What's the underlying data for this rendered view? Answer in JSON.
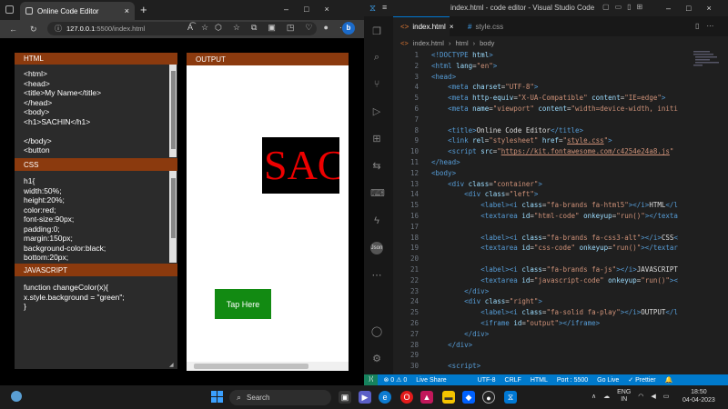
{
  "browser": {
    "tab_title": "Online Code Editor",
    "tab_close": "×",
    "new_tab": "+",
    "address_host": "127.0.0.1",
    "address_path": ":5500/index.html",
    "window_controls": [
      "–",
      "□",
      "×"
    ],
    "icons": [
      "back-icon",
      "reload-icon",
      "info-icon",
      "read-aloud-icon",
      "font-icon",
      "extensions-icon",
      "favorites-icon",
      "collections-icon",
      "profile-icon",
      "bing-icon"
    ]
  },
  "editor": {
    "html_panel": {
      "label": "HTML",
      "code": "<html>\n<head>\n<title>My Name</title>\n</head>\n<body>\n<h1>SACHIN</h1>\n\n</body>\n<button"
    },
    "css_panel": {
      "label": "CSS",
      "code": "h1{\nwidth:50%;\nheight:20%;\ncolor:red;\nfont-size:90px;\npadding:0;\nmargin:150px;\nbackground-color:black;\nbottom:20px;"
    },
    "js_panel": {
      "label": "JAVASCRIPT",
      "code": "function changeColor(x){\nx.style.background = \"green\";\n}"
    },
    "output_panel": {
      "label": "OUTPUT",
      "heading_text": "SACHIN",
      "button_text": "Tap Here"
    }
  },
  "vscode": {
    "title": "index.html - code editor - Visual Studio Code",
    "tabs": [
      {
        "label": "index.html",
        "active": true,
        "close": "×"
      },
      {
        "label": "style.css",
        "active": false
      }
    ],
    "breadcrumb": [
      "index.html",
      "html",
      "body"
    ],
    "lines": [
      {
        "n": "1",
        "html": "<span class=\"tg\">&lt;!DOCTYPE</span> <span class=\"at\">html</span><span class=\"tg\">&gt;</span>"
      },
      {
        "n": "2",
        "html": "<span class=\"tg\">&lt;html</span> <span class=\"at\">lang</span>=<span class=\"st\">\"en\"</span><span class=\"tg\">&gt;</span>"
      },
      {
        "n": "3",
        "html": "<span class=\"tg\">&lt;head&gt;</span>"
      },
      {
        "n": "4",
        "html": "    <span class=\"tg\">&lt;meta</span> <span class=\"at\">charset</span>=<span class=\"st\">\"UTF-8\"</span><span class=\"tg\">&gt;</span>"
      },
      {
        "n": "5",
        "html": "    <span class=\"tg\">&lt;meta</span> <span class=\"at\">http-equiv</span>=<span class=\"st\">\"X-UA-Compatible\"</span> <span class=\"at\">content</span>=<span class=\"st\">\"IE=edge\"</span><span class=\"tg\">&gt;</span>"
      },
      {
        "n": "6",
        "html": "    <span class=\"tg\">&lt;meta</span> <span class=\"at\">name</span>=<span class=\"st\">\"viewport\"</span> <span class=\"at\">content</span>=<span class=\"st\">\"width=device-width, initi</span>"
      },
      {
        "n": "7",
        "html": ""
      },
      {
        "n": "8",
        "html": "    <span class=\"tg\">&lt;title&gt;</span><span class=\"tx\">Online Code Editor</span><span class=\"tg\">&lt;/title&gt;</span>"
      },
      {
        "n": "9",
        "html": "    <span class=\"tg\">&lt;link</span> <span class=\"at\">rel</span>=<span class=\"st\">\"stylesheet\"</span> <span class=\"at\">href</span>=<span class=\"st\">\"<u>style.css</u>\"</span><span class=\"tg\">&gt;</span>"
      },
      {
        "n": "10",
        "html": "    <span class=\"tg\">&lt;script</span> <span class=\"at\">src</span>=<span class=\"st\">\"<u>https://kit.fontawesome.com/c4254e24a8.js</u>\"</span>"
      },
      {
        "n": "11",
        "html": "<span class=\"tg\">&lt;/head&gt;</span>"
      },
      {
        "n": "12",
        "html": "<span class=\"tg\">&lt;body&gt;</span>"
      },
      {
        "n": "13",
        "html": "    <span class=\"tg\">&lt;div</span> <span class=\"at\">class</span>=<span class=\"st\">\"container\"</span><span class=\"tg\">&gt;</span>"
      },
      {
        "n": "14",
        "html": "        <span class=\"tg\">&lt;div</span> <span class=\"at\">class</span>=<span class=\"st\">\"left\"</span><span class=\"tg\">&gt;</span>"
      },
      {
        "n": "15",
        "html": "            <span class=\"tg\">&lt;label&gt;&lt;i</span> <span class=\"at\">class</span>=<span class=\"st\">\"fa-brands fa-html5\"</span><span class=\"tg\">&gt;&lt;/i&gt;</span><span class=\"tx\">HTML</span><span class=\"tg\">&lt;/l</span>"
      },
      {
        "n": "16",
        "html": "            <span class=\"tg\">&lt;textarea</span> <span class=\"at\">id</span>=<span class=\"st\">\"html-code\"</span> <span class=\"at\">onkeyup</span>=<span class=\"st\">\"run()\"</span><span class=\"tg\">&gt;&lt;/texta</span>"
      },
      {
        "n": "17",
        "html": ""
      },
      {
        "n": "18",
        "html": "            <span class=\"tg\">&lt;label&gt;&lt;i</span> <span class=\"at\">class</span>=<span class=\"st\">\"fa-brands fa-css3-alt\"</span><span class=\"tg\">&gt;&lt;/i&gt;</span><span class=\"tx\">CSS</span><span class=\"tg\">&lt;</span>"
      },
      {
        "n": "19",
        "html": "            <span class=\"tg\">&lt;textarea</span> <span class=\"at\">id</span>=<span class=\"st\">\"css-code\"</span> <span class=\"at\">onkeyup</span>=<span class=\"st\">\"run()\"</span><span class=\"tg\">&gt;&lt;/textar</span>"
      },
      {
        "n": "20",
        "html": ""
      },
      {
        "n": "21",
        "html": "            <span class=\"tg\">&lt;label&gt;&lt;i</span> <span class=\"at\">class</span>=<span class=\"st\">\"fa-brands fa-js\"</span><span class=\"tg\">&gt;&lt;/i&gt;</span><span class=\"tx\">JAVASCRIPT</span>"
      },
      {
        "n": "22",
        "html": "            <span class=\"tg\">&lt;textarea</span> <span class=\"at\">id</span>=<span class=\"st\">\"javascript-code\"</span> <span class=\"at\">onkeyup</span>=<span class=\"st\">\"run()\"</span><span class=\"tg\">&gt;&lt;</span>"
      },
      {
        "n": "23",
        "html": "        <span class=\"tg\">&lt;/div&gt;</span>"
      },
      {
        "n": "24",
        "html": "        <span class=\"tg\">&lt;div</span> <span class=\"at\">class</span>=<span class=\"st\">\"right\"</span><span class=\"tg\">&gt;</span>"
      },
      {
        "n": "25",
        "html": "            <span class=\"tg\">&lt;label&gt;&lt;i</span> <span class=\"at\">class</span>=<span class=\"st\">\"fa-solid fa-play\"</span><span class=\"tg\">&gt;&lt;/i&gt;</span><span class=\"tx\">OUTPUT</span><span class=\"tg\">&lt;/l</span>"
      },
      {
        "n": "26",
        "html": "            <span class=\"tg\">&lt;iframe</span> <span class=\"at\">id</span>=<span class=\"st\">\"output\"</span><span class=\"tg\">&gt;&lt;/iframe&gt;</span>"
      },
      {
        "n": "27",
        "html": "        <span class=\"tg\">&lt;/div&gt;</span>"
      },
      {
        "n": "28",
        "html": "    <span class=\"tg\">&lt;/div&gt;</span>"
      },
      {
        "n": "29",
        "html": ""
      },
      {
        "n": "30",
        "html": "    <span class=\"tg\">&lt;script&gt;</span>"
      }
    ],
    "status": {
      "problems": "⊗ 0 ⚠ 0",
      "live_share": "Live Share",
      "encoding": "UTF-8",
      "eol": "CRLF",
      "language": "HTML",
      "port": "Port : 5500",
      "golive": "Go Live",
      "prettier": "✓ Prettier"
    }
  },
  "taskbar": {
    "search_label": "Search",
    "lang": "ENG",
    "lang2": "IN",
    "time": "18:50",
    "date": "04-04-2023"
  }
}
